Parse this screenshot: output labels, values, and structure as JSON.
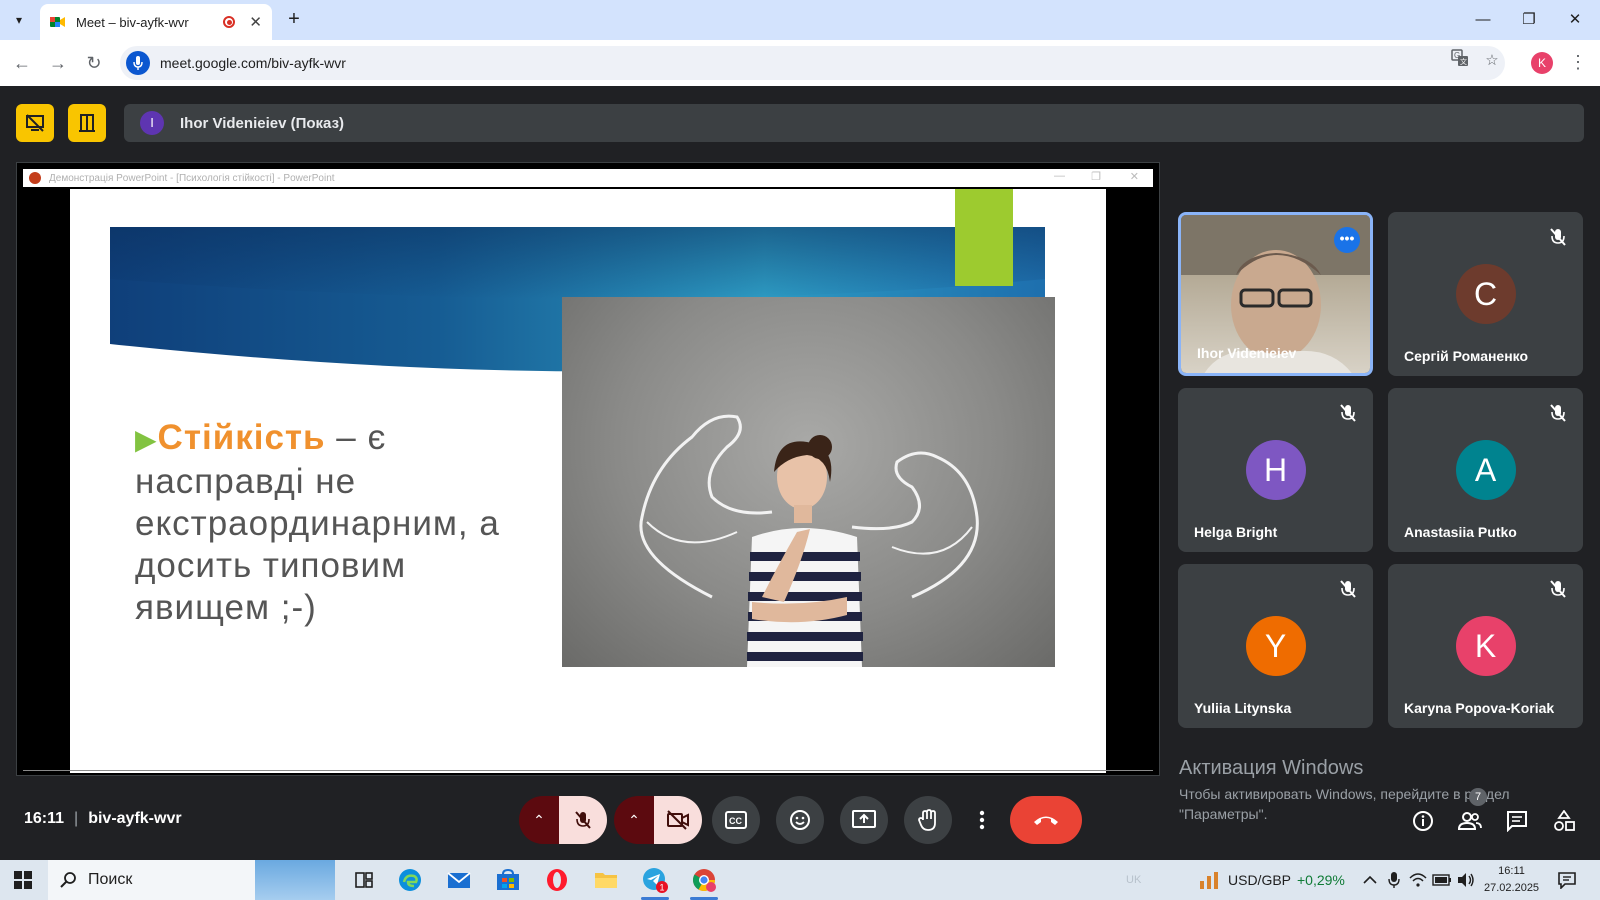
{
  "browser": {
    "tab_title": "Meet – biv-ayfk-wvr",
    "url": "meet.google.com/biv-ayfk-wvr",
    "profile_initial": "K"
  },
  "meet": {
    "presenter_initial": "I",
    "presenter_label": "Ihor Videnieiev (Показ)",
    "shared_window_title": "Демонстрація PowerPoint - [Психологія стійкості] - PowerPoint",
    "slide": {
      "highlight": "Стійкість",
      "rest": " – є насправді не екстраординарним, а досить типовим явищем ;-)"
    },
    "participants": [
      {
        "name": "Ihor Videnieiev",
        "initial": "",
        "color": "",
        "video": true,
        "muted": false
      },
      {
        "name": "Сергій Романенко",
        "initial": "С",
        "color": "#6d3b2d",
        "video": false,
        "muted": true
      },
      {
        "name": "Helga Bright",
        "initial": "H",
        "color": "#7e57c2",
        "video": false,
        "muted": true
      },
      {
        "name": "Anastasiia Putko",
        "initial": "A",
        "color": "#00838f",
        "video": false,
        "muted": true
      },
      {
        "name": "Yuliia Litynska",
        "initial": "Y",
        "color": "#ef6c00",
        "video": false,
        "muted": true
      },
      {
        "name": "Karyna Popova-Koriak",
        "initial": "K",
        "color": "#e8416a",
        "video": false,
        "muted": true
      }
    ],
    "time": "16:11",
    "meeting_code": "biv-ayfk-wvr",
    "people_count": "7"
  },
  "windows_activation": {
    "title": "Активация Windows",
    "line1": "Чтобы активировать Windows, перейдите в раздел",
    "line2": "\"Параметры\"."
  },
  "taskbar": {
    "search_placeholder": "Поиск",
    "telegram_badge": "1",
    "lang": "UK",
    "ticker_label": "USD/GBP",
    "ticker_change": "+0,29%",
    "clock_time": "16:11",
    "clock_date": "27.02.2025"
  },
  "colors": {
    "meet_bg": "#202124",
    "tile_bg": "#3c4043",
    "accent_yellow": "#f9c500",
    "hangup_red": "#ea4335",
    "slide_orange": "#f0912e",
    "slide_green": "#82c341"
  }
}
